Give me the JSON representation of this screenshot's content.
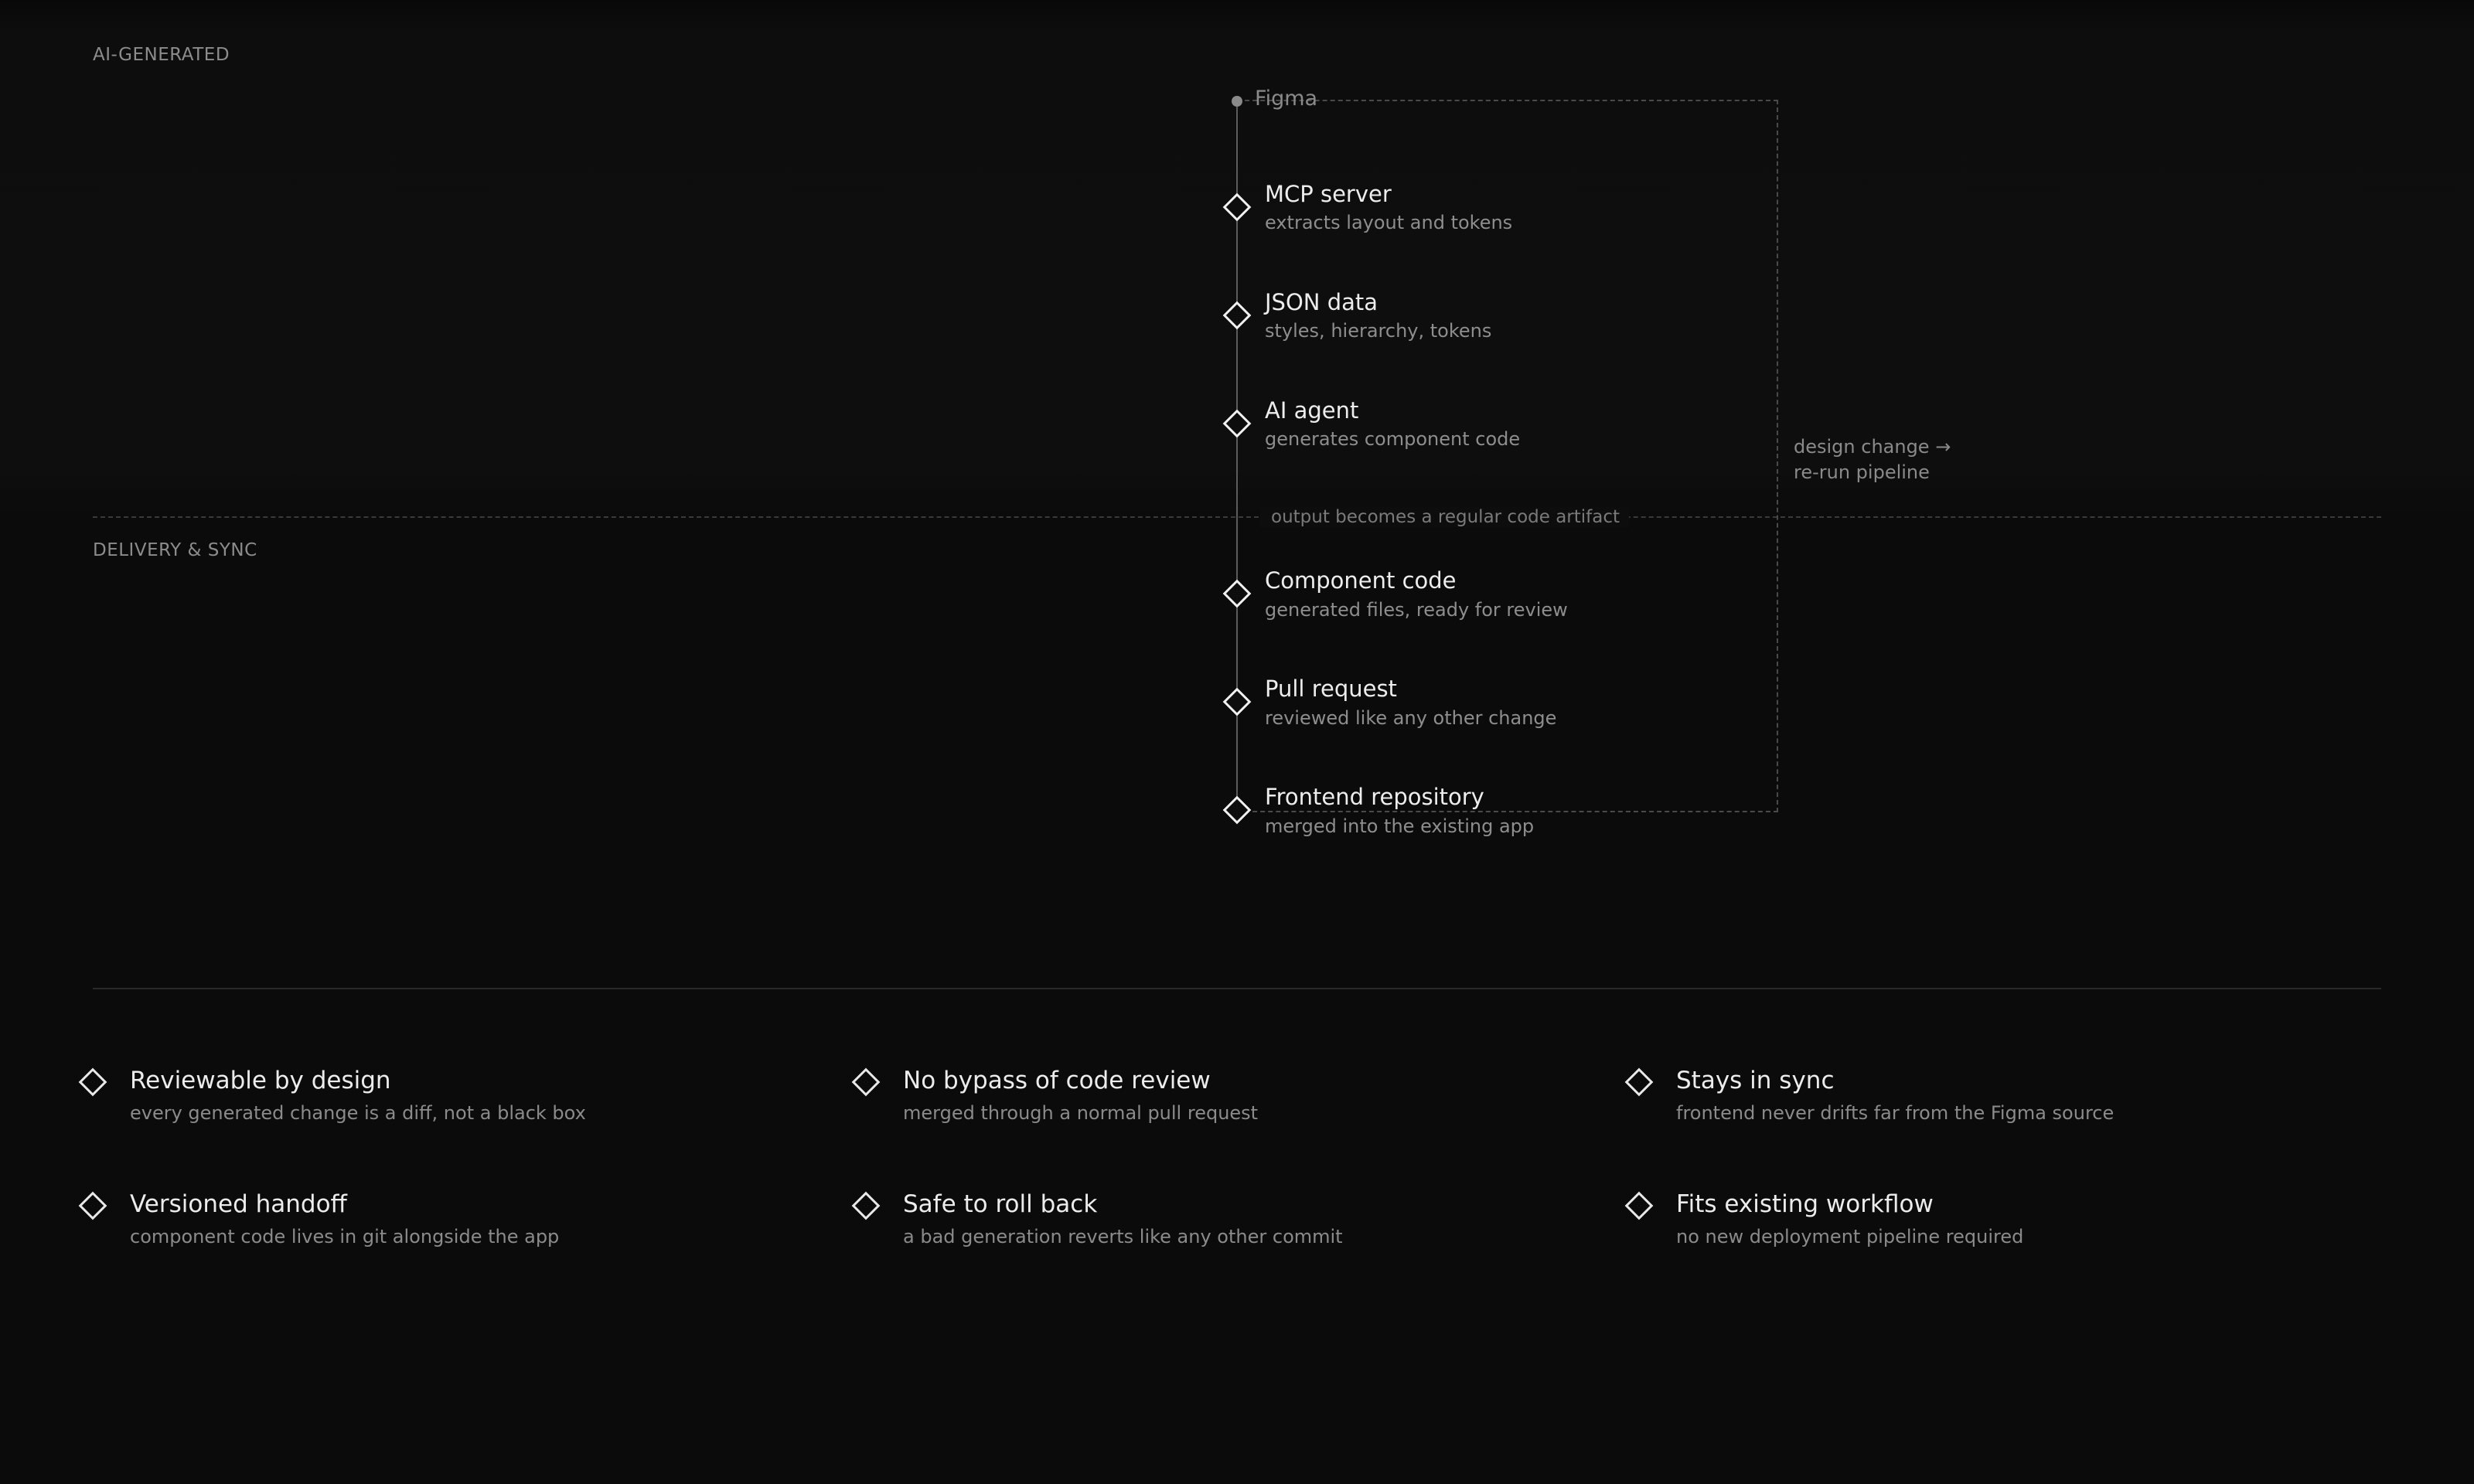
{
  "sections": {
    "ai_generated_label": "AI-GENERATED",
    "delivery_label": "DELIVERY & SYNC"
  },
  "pipeline": {
    "source": "Figma",
    "nodes": [
      {
        "title": "MCP server",
        "subtitle": "extracts layout and tokens"
      },
      {
        "title": "JSON data",
        "subtitle": "styles, hierarchy, tokens"
      },
      {
        "title": "AI agent",
        "subtitle": "generates component code"
      },
      {
        "title": "Component code",
        "subtitle": "generated files, ready for review"
      },
      {
        "title": "Pull request",
        "subtitle": "reviewed like any other change"
      },
      {
        "title": "Frontend repository",
        "subtitle": "merged into the existing app"
      }
    ],
    "handoff_note": "output becomes a regular code artifact",
    "loop_label_line1": "design change →",
    "loop_label_line2": "re-run pipeline"
  },
  "benefits": [
    {
      "title": "Reviewable by design",
      "subtitle": "every generated change is a diff, not a black box"
    },
    {
      "title": "No bypass of code review",
      "subtitle": "merged through a normal pull request"
    },
    {
      "title": "Stays in sync",
      "subtitle": "frontend never drifts far from the Figma source"
    },
    {
      "title": "Versioned handoff",
      "subtitle": "component code lives in git alongside the app"
    },
    {
      "title": "Safe to roll back",
      "subtitle": "a bad generation reverts like any other commit"
    },
    {
      "title": "Fits existing workflow",
      "subtitle": "no new deployment pipeline required"
    }
  ],
  "colors": {
    "background": "#0b0b0b",
    "text_primary": "#ececec",
    "text_secondary": "#8b8b8b",
    "line": "#5c5c5c"
  }
}
